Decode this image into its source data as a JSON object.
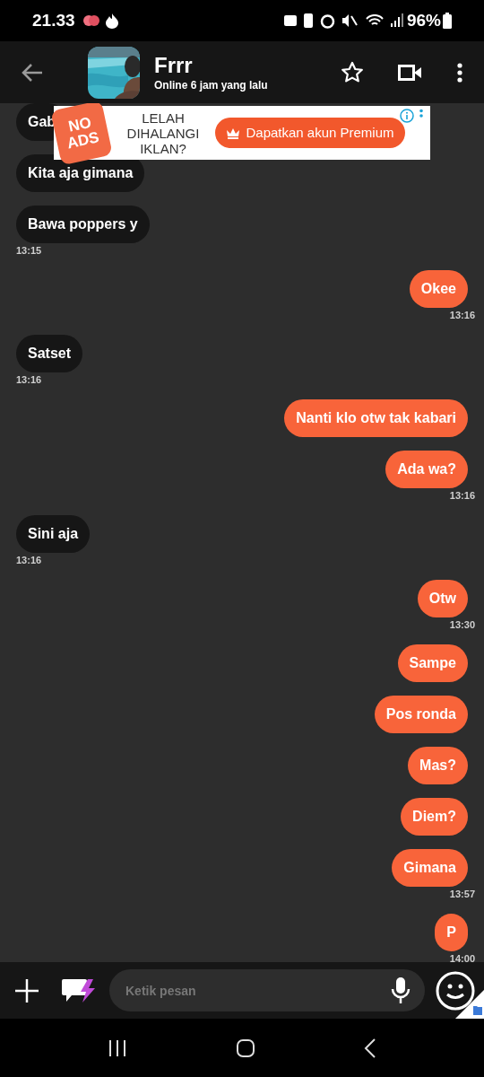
{
  "status_bar": {
    "time": "21.33",
    "battery": "96%"
  },
  "header": {
    "name": "Frrr",
    "status": "Online 6 jam yang lalu"
  },
  "ad": {
    "badge_lines": [
      "NO",
      "ADS"
    ],
    "headline_lines": [
      "LELAH",
      "DIHALANGI",
      "IKLAN?"
    ],
    "button": "Dapatkan akun Premium"
  },
  "messages": [
    {
      "outgoing": false,
      "text": "Gab"
    },
    {
      "outgoing": false,
      "text": "Kita aja gimana"
    },
    {
      "outgoing": false,
      "text": "Bawa poppers y",
      "time": "13:15"
    },
    {
      "outgoing": true,
      "text": "Okee",
      "time": "13:16"
    },
    {
      "outgoing": false,
      "text": "Satset",
      "time": "13:16"
    },
    {
      "outgoing": true,
      "text": "Nanti klo otw tak kabari"
    },
    {
      "outgoing": true,
      "text": "Ada wa?",
      "time": "13:16"
    },
    {
      "outgoing": false,
      "text": "Sini aja",
      "time": "13:16"
    },
    {
      "outgoing": true,
      "text": "Otw",
      "time": "13:30"
    },
    {
      "outgoing": true,
      "text": "Sampe"
    },
    {
      "outgoing": true,
      "text": "Pos ronda"
    },
    {
      "outgoing": true,
      "text": "Mas?"
    },
    {
      "outgoing": true,
      "text": "Diem?"
    },
    {
      "outgoing": true,
      "text": "Gimana",
      "time": "13:57"
    },
    {
      "outgoing": true,
      "text": "P",
      "time": "14:00"
    }
  ],
  "composer": {
    "placeholder": "Ketik pesan"
  }
}
